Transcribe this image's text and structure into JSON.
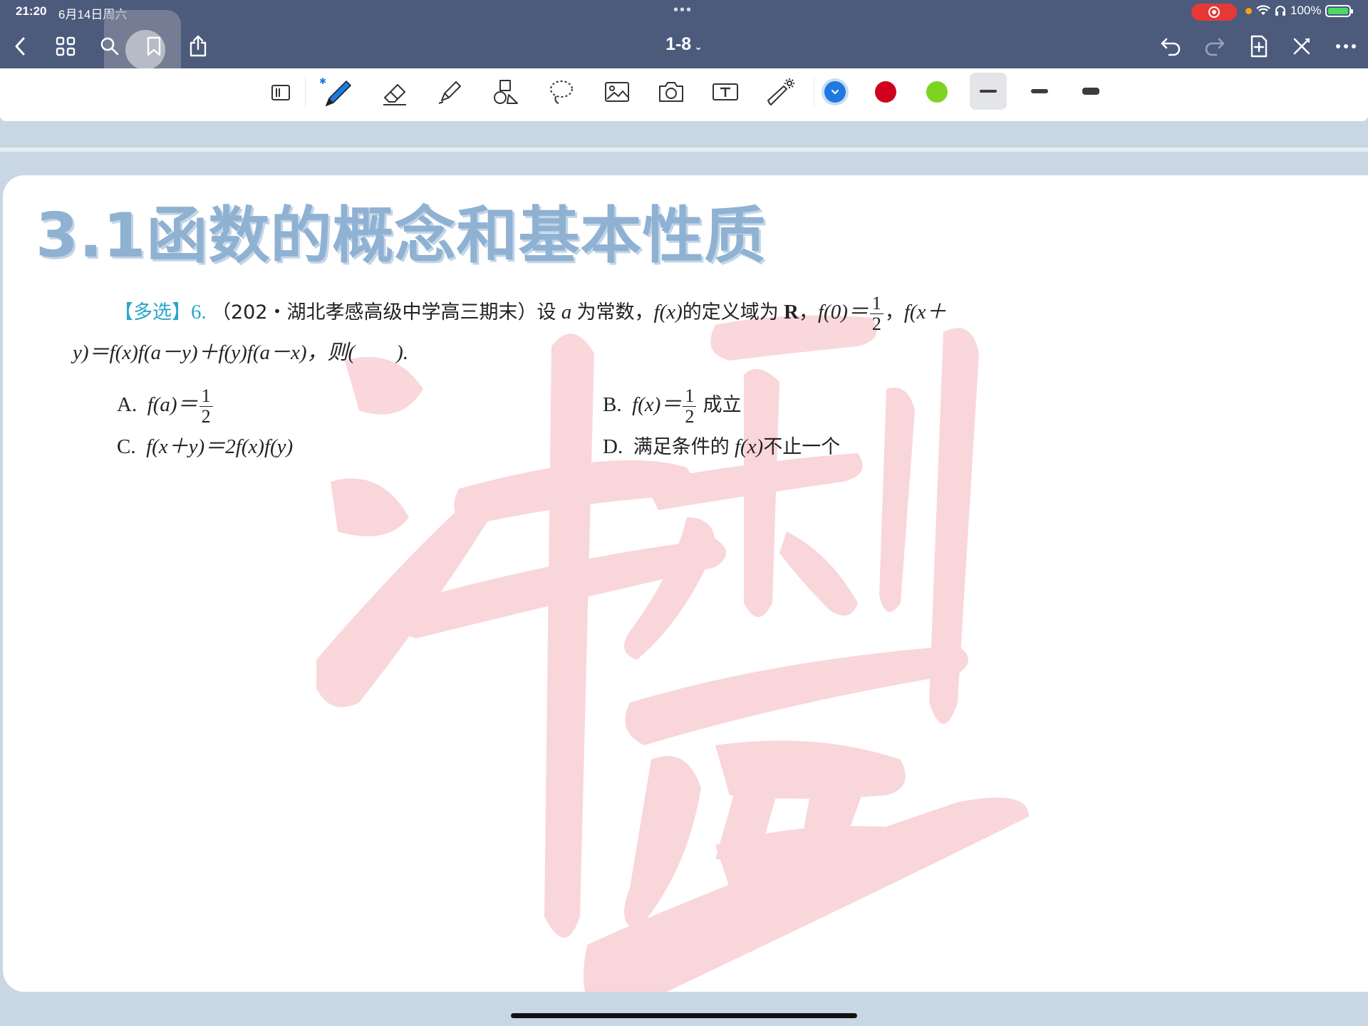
{
  "status_bar": {
    "time": "21:20",
    "date": "6月14日周六",
    "center_dots": "•••",
    "battery_percent": "100%"
  },
  "nav": {
    "doc_title": "1-8",
    "icons": [
      "back-icon",
      "grid-icon",
      "search-icon",
      "bookmark-icon",
      "share-icon",
      "undo-icon",
      "redo-icon",
      "add-page-icon",
      "close-icon",
      "more-icon"
    ]
  },
  "toolbar": {
    "tools": [
      "page-mode-icon",
      "pen-icon",
      "eraser-icon",
      "highlighter-icon",
      "shapes-icon",
      "lasso-icon",
      "image-icon",
      "camera-icon",
      "text-box-icon",
      "laser-pointer-icon"
    ],
    "colors": [
      "#1f7ae0",
      "#d0021b",
      "#7ed321"
    ],
    "selected_color": "#1f7ae0",
    "stroke_widths": [
      "thin",
      "medium",
      "thick"
    ],
    "selected_stroke": "thin"
  },
  "page": {
    "chapter_title": "3.1函数的概念和基本性质",
    "question": {
      "tag": "【多选】",
      "number": "6.",
      "line1_a": "（202・湖北孝感高级中学高三期末）设",
      "var_a": "a",
      "line1_b": "为常数，",
      "fx": "f(x)",
      "line1_c": "的定义域为",
      "domain": "R",
      "line1_d": "，",
      "f0": "f(0)＝",
      "half_num": "1",
      "half_den": "2",
      "line1_e": "，",
      "line1_f": "f(x＋",
      "line2": "y)＝f(x)f(a－y)＋f(y)f(a－x)，则(　　)."
    },
    "options": [
      {
        "label": "A.",
        "expr": "f(a)＝",
        "num": "1",
        "den": "2",
        "suffix": ""
      },
      {
        "label": "B.",
        "expr": "f(x)＝",
        "num": "1",
        "den": "2",
        "suffix": "成立"
      },
      {
        "label": "C.",
        "expr": "f(x＋y)＝2f(x)f(y)",
        "num": "",
        "den": "",
        "suffix": ""
      },
      {
        "label": "D.",
        "expr": "满足条件的",
        "fx": "f(x)",
        "suffix": "不止一个"
      }
    ]
  }
}
